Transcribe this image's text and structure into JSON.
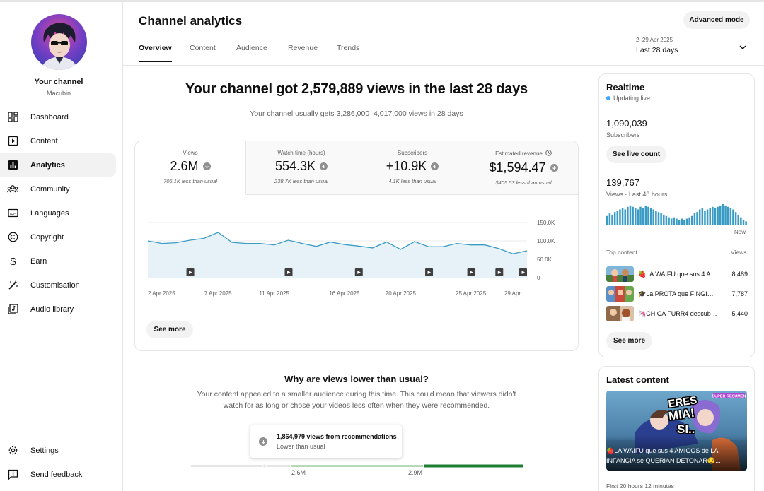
{
  "channel": {
    "name": "Your channel",
    "handle": "Macubin",
    "avatar_signature": "Macubin"
  },
  "sidebar": {
    "items": [
      {
        "label": "Dashboard",
        "icon": "dashboard-icon"
      },
      {
        "label": "Content",
        "icon": "content-icon"
      },
      {
        "label": "Analytics",
        "icon": "analytics-icon",
        "active": true
      },
      {
        "label": "Community",
        "icon": "community-icon"
      },
      {
        "label": "Languages",
        "icon": "languages-icon"
      },
      {
        "label": "Copyright",
        "icon": "copyright-icon"
      },
      {
        "label": "Earn",
        "icon": "earn-icon"
      },
      {
        "label": "Customisation",
        "icon": "customisation-icon"
      },
      {
        "label": "Audio library",
        "icon": "audio-library-icon"
      }
    ],
    "bottom": [
      {
        "label": "Settings",
        "icon": "gear-icon"
      },
      {
        "label": "Send feedback",
        "icon": "feedback-icon"
      }
    ]
  },
  "header": {
    "title": "Channel analytics",
    "advanced_mode": "Advanced mode",
    "tabs": [
      "Overview",
      "Content",
      "Audience",
      "Revenue",
      "Trends"
    ],
    "active_tab": "Overview",
    "date_range_small": "2–29 Apr 2025",
    "date_range": "Last 28 days"
  },
  "summary": {
    "headline": "Your channel got 2,579,889 views in the last 28 days",
    "subhead": "Your channel usually gets 3,286,000–4,017,000 views in 28 days"
  },
  "metrics": [
    {
      "label": "Views",
      "value": "2.6M",
      "note": "706.1K less than usual",
      "active": true
    },
    {
      "label": "Watch time (hours)",
      "value": "554.3K",
      "note": "238.7K less than usual"
    },
    {
      "label": "Subscribers",
      "value": "+10.9K",
      "note": "4.1K less than usual"
    },
    {
      "label": "Estimated revenue",
      "value": "$1,594.47",
      "note": "$405.53 less than usual"
    }
  ],
  "chart_data": {
    "type": "area",
    "series": [
      {
        "values": [
          100000,
          93000,
          95000,
          102000,
          107000,
          123000,
          96000,
          93000,
          93000,
          89000,
          102000,
          93000,
          85000,
          97000,
          90000,
          86000,
          81000,
          97000,
          77000,
          98000,
          84000,
          84000,
          93000,
          89000,
          89000,
          79000,
          65000,
          73000
        ]
      }
    ],
    "x_tick_labels": [
      "2 Apr 2025",
      "7 Apr 2025",
      "11 Apr 2025",
      "16 Apr 2025",
      "20 Apr 2025",
      "25 Apr 2025",
      "29 Apr ..."
    ],
    "y_tick_labels": [
      "150.0K",
      "100.0K",
      "50.0K",
      "0"
    ],
    "ylim": [
      0,
      150000
    ],
    "video_markers": 8,
    "color": "#3a9cc4"
  },
  "see_more": "See more",
  "why": {
    "title": "Why are views lower than usual?",
    "text": "Your content appealed to a smaller audience during this time. This could mean that viewers didn't watch for as long or chose your videos less often when they were recommended.",
    "tooltip_title": "1,864,979 views from recommendations",
    "tooltip_sub": "Lower than usual",
    "range_low": "2.6M",
    "range_high": "2.9M"
  },
  "realtime": {
    "title": "Realtime",
    "live": "Updating live",
    "subscribers": "1,090,039",
    "subscribers_label": "Subscribers",
    "live_count_btn": "See live count",
    "views": "139,767",
    "views_label": "Views · Last 48 hours",
    "now": "Now",
    "bars": [
      6,
      8,
      7,
      9,
      10,
      11,
      12,
      11,
      13,
      14,
      13,
      12,
      11,
      13,
      12,
      14,
      13,
      12,
      11,
      10,
      9,
      8,
      7,
      6,
      5,
      4,
      5,
      4,
      3,
      4,
      3,
      4,
      5,
      6,
      8,
      9,
      11,
      12,
      10,
      11,
      12,
      13,
      12,
      13,
      14,
      15,
      14,
      13,
      12,
      11,
      9,
      7,
      5,
      3,
      2
    ],
    "top_content_label": "Top content",
    "views_col": "Views",
    "top_content": [
      {
        "title": "🍓LA WAIFU que sus 4 A...",
        "views": "8,489"
      },
      {
        "title": "🎓La PROTA que FINGIA ...",
        "views": "7,787"
      },
      {
        "title": "🦄CHICA FURR4 descubr...",
        "views": "5,440"
      }
    ],
    "see_more": "See more"
  },
  "latest": {
    "title": "Latest content",
    "thumb_text_1": "ERES",
    "thumb_text_2": "MIA!",
    "thumb_text_3": "SI..",
    "thumb_badge": "SUPER RESUMEN",
    "caption": "🍓LA WAIFU que sus 4 AMIGOS de LA INFANCIA se QUERIAN DETONAR😏...",
    "foot": "First 20 hours 12 minutes"
  }
}
